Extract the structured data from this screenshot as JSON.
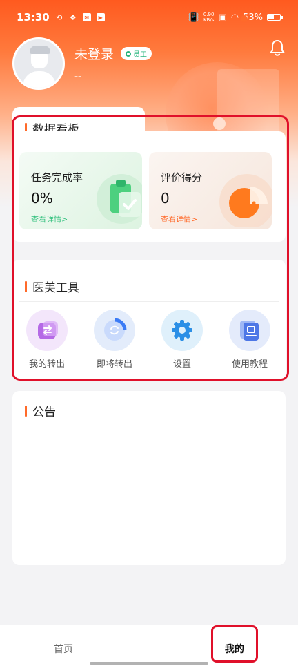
{
  "status_bar": {
    "time": "13:30",
    "network_speed_value": "0.90",
    "network_speed_unit": "KB/s",
    "battery_percent": "53%",
    "battery_level": 0.53
  },
  "profile": {
    "name": "未登录",
    "role_badge": "员工",
    "sub_text": "--"
  },
  "dashboard": {
    "title": "数据看板",
    "cards": [
      {
        "label": "任务完成率",
        "value": "0%",
        "link": "查看详情>"
      },
      {
        "label": "评价得分",
        "value": "0",
        "link": "查看详情>"
      }
    ]
  },
  "tools": {
    "title": "医美工具",
    "items": [
      {
        "label": "我的转出",
        "icon": "transfer-out-icon"
      },
      {
        "label": "即将转出",
        "icon": "upcoming-transfer-icon"
      },
      {
        "label": "设置",
        "icon": "settings-gear-icon"
      },
      {
        "label": "使用教程",
        "icon": "tutorial-icon"
      }
    ]
  },
  "notice": {
    "title": "公告"
  },
  "tab_bar": {
    "home_label": "首页",
    "mine_label": "我的"
  },
  "colors": {
    "brand_orange": "#ff5a1f",
    "accent_green": "#2fbf7b",
    "highlight_red": "#e0102a"
  }
}
